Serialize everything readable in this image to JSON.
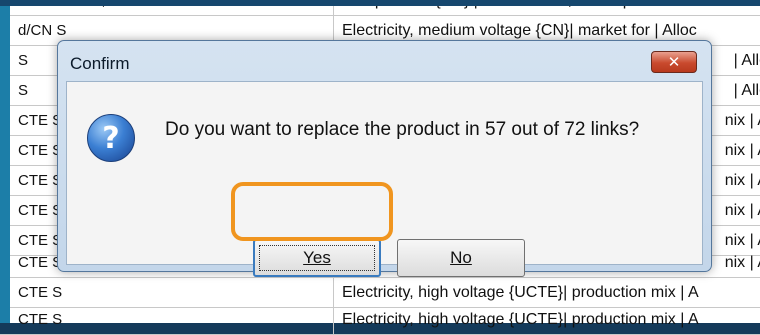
{
  "background_table": {
    "rows": [
      {
        "col1": "Manufacture, ...",
        "col2": "Scrap in use {CN} | treatment of, municipal..."
      },
      {
        "col1": "d/CN S",
        "col2": "Electricity, medium voltage {CN}| market for | Alloc"
      },
      {
        "col1": "S",
        "col2": "| Allo"
      },
      {
        "col1": "S",
        "col2": "| Allo"
      },
      {
        "col1": "CTE S",
        "col2": "nix | A"
      },
      {
        "col1": "CTE S",
        "col2": "nix | A"
      },
      {
        "col1": "CTE S",
        "col2": "nix | A"
      },
      {
        "col1": "CTE S",
        "col2": "nix | A"
      },
      {
        "col1": "CTE S",
        "col2": "nix | A"
      },
      {
        "col1": "CTE S",
        "col2": "nix | A"
      },
      {
        "col1": "CTE S",
        "col2": "Electricity, high voltage {UCTE}| production mix | A"
      },
      {
        "col1": "CTE S",
        "col2": "Electricity, high voltage {UCTE}| production mix | A"
      }
    ]
  },
  "dialog": {
    "title": "Confirm",
    "close_icon": "close-icon",
    "icon": "question-icon",
    "message": "Do you want to replace the product in 57 out of 72 links?",
    "yes_label": "Yes",
    "no_label": "No"
  },
  "colors": {
    "highlight": "#f0951f",
    "dialog_frame": "#c3d6ea",
    "close_button": "#c94a2e"
  }
}
